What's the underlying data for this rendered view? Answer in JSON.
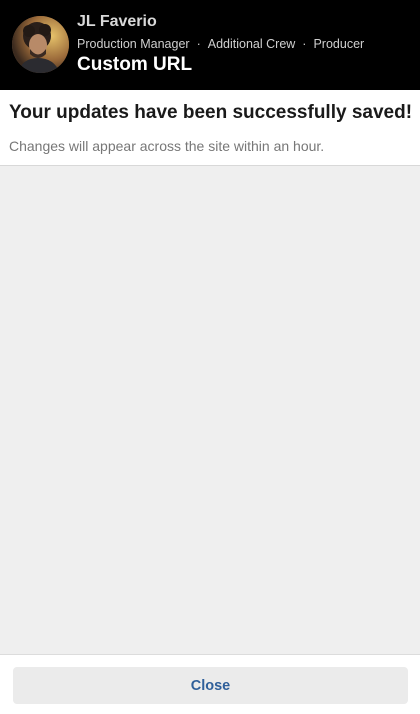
{
  "header": {
    "name": "JL Faverio",
    "roles": [
      "Production Manager",
      "Additional Crew",
      "Producer"
    ],
    "separator": "·",
    "page_title": "Custom URL",
    "avatar_icon": "user-avatar-photo"
  },
  "notice": {
    "title": "Your updates have been successfully saved!",
    "subtitle": "Changes will appear across the site within an hour."
  },
  "footer": {
    "close_label": "Close"
  },
  "colors": {
    "header_bg": "#000000",
    "page_bg": "#efefef",
    "button_text": "#2f5f9a",
    "button_bg": "#ebebeb"
  }
}
